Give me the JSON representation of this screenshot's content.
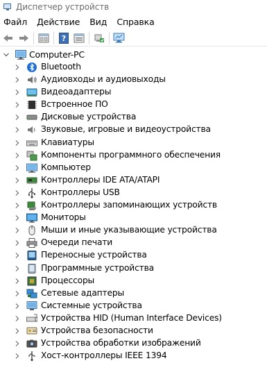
{
  "window": {
    "title": "Диспетчер устройств"
  },
  "menu": [
    "Файл",
    "Действие",
    "Вид",
    "Справка"
  ],
  "toolbar": {
    "buttons": [
      "back-arrow-icon",
      "forward-arrow-icon",
      "properties-icon",
      "help-icon",
      "view-icon",
      "update-driver-icon",
      "scan-hardware-icon"
    ]
  },
  "tree": {
    "root": {
      "label": "Computer-PC",
      "expanded": true,
      "icon": "computer-icon"
    },
    "items": [
      {
        "label": "Bluetooth",
        "icon": "bluetooth-icon"
      },
      {
        "label": "Аудиовходы и аудиовыходы",
        "icon": "audio-io-icon"
      },
      {
        "label": "Видеоадаптеры",
        "icon": "display-adapter-icon"
      },
      {
        "label": "Встроенное ПО",
        "icon": "firmware-icon"
      },
      {
        "label": "Дисковые устройства",
        "icon": "disk-drive-icon"
      },
      {
        "label": "Звуковые, игровые и видеоустройства",
        "icon": "sound-icon"
      },
      {
        "label": "Клавиатуры",
        "icon": "keyboard-icon"
      },
      {
        "label": "Компоненты программного обеспечения",
        "icon": "software-component-icon"
      },
      {
        "label": "Компьютер",
        "icon": "computer-icon"
      },
      {
        "label": "Контроллеры IDE ATA/ATAPI",
        "icon": "ide-controller-icon"
      },
      {
        "label": "Контроллеры USB",
        "icon": "usb-icon"
      },
      {
        "label": "Контроллеры запоминающих устройств",
        "icon": "storage-controller-icon"
      },
      {
        "label": "Мониторы",
        "icon": "monitor-icon"
      },
      {
        "label": "Мыши и иные указывающие устройства",
        "icon": "mouse-icon"
      },
      {
        "label": "Очереди печати",
        "icon": "printer-icon"
      },
      {
        "label": "Переносные устройства",
        "icon": "portable-device-icon"
      },
      {
        "label": "Программные устройства",
        "icon": "software-device-icon"
      },
      {
        "label": "Процессоры",
        "icon": "processor-icon"
      },
      {
        "label": "Сетевые адаптеры",
        "icon": "network-adapter-icon"
      },
      {
        "label": "Системные устройства",
        "icon": "system-device-icon"
      },
      {
        "label": "Устройства HID (Human Interface Devices)",
        "icon": "hid-icon"
      },
      {
        "label": "Устройства безопасности",
        "icon": "security-device-icon"
      },
      {
        "label": "Устройства обработки изображений",
        "icon": "imaging-device-icon"
      },
      {
        "label": "Хост-контроллеры IEEE 1394",
        "icon": "ieee1394-icon"
      }
    ]
  }
}
